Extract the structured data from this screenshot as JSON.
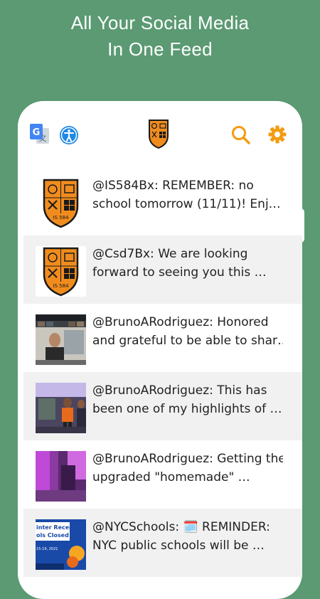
{
  "headline": {
    "line1": "All Your Social Media",
    "line2": "In One Feed"
  },
  "toolbar": {
    "translate_icon": "google-translate-icon",
    "accessibility_icon": "accessibility-icon",
    "logo_icon": "school-shield-logo",
    "search_icon": "search-icon",
    "settings_icon": "gear-icon",
    "accent_color": "#f39c12"
  },
  "feed": [
    {
      "line1": "@IS584Bx: REMEMBER: no",
      "line2": "school tomorrow (11/11)! Enj…",
      "thumb": "school-shield-logo"
    },
    {
      "line1": "@Csd7Bx: We are looking",
      "line2": "forward to seeing you this …",
      "thumb": "school-shield-logo"
    },
    {
      "line1": "@BrunoARodriguez: Honored",
      "line2": "and grateful to be able to shar…",
      "thumb": "video-call-photo"
    },
    {
      "line1": "@BrunoARodriguez: This has",
      "line2": "been one of my highlights of …",
      "thumb": "students-photo"
    },
    {
      "line1": "@BrunoARodriguez: Getting the",
      "line2": "upgraded \"homemade\" …",
      "thumb": "purple-light-photo"
    },
    {
      "line1": "@NYCSchools: 🗓️ REMINDER:",
      "line2": "NYC public schools will be …",
      "thumb": "winter-recess-graphic",
      "thumb_text1": "inter Recess",
      "thumb_text2": "ols Closed",
      "thumb_text3": "15-19, 2021"
    }
  ]
}
